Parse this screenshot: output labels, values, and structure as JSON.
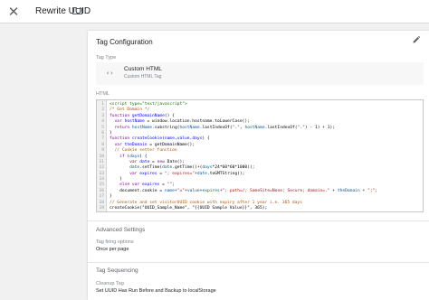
{
  "header": {
    "title": "Rewrite UUID",
    "close_glyph": "✕",
    "icons": [
      "close-icon",
      "folder-icon"
    ]
  },
  "tag_configuration": {
    "title": "Tag Configuration",
    "edit_icon": "pencil-icon",
    "tag_type_label": "Tag Type",
    "tag_type_name": "Custom HTML",
    "tag_type_description": "Custom HTML Tag",
    "tag_type_icon": "code-icon",
    "tag_type_icon_glyph": "‹›",
    "html_label": "HTML",
    "code_lines": [
      {
        "n": "1",
        "parts": [
          {
            "t": "<script type=\"text/javascript\">",
            "c": "c-tag"
          }
        ]
      },
      {
        "n": "2",
        "parts": [
          {
            "t": "/* Get Domain */",
            "c": "c-com"
          }
        ]
      },
      {
        "n": "3",
        "parts": [
          {
            "t": "function ",
            "c": "c-kw"
          },
          {
            "t": "getDomainName",
            "c": "c-def"
          },
          {
            "t": "() {",
            "c": ""
          }
        ]
      },
      {
        "n": "4",
        "parts": [
          {
            "t": "  var ",
            "c": "c-kw"
          },
          {
            "t": "hostName",
            "c": "c-def"
          },
          {
            "t": " = window.location.hostname.toLowerCase();",
            "c": ""
          }
        ]
      },
      {
        "n": "5",
        "parts": [
          {
            "t": "  return ",
            "c": "c-kw"
          },
          {
            "t": "hostName",
            "c": "c-var"
          },
          {
            "t": ".substring(",
            "c": ""
          },
          {
            "t": "hostName",
            "c": "c-var"
          },
          {
            "t": ".lastIndexOf(",
            "c": ""
          },
          {
            "t": "\".\"",
            "c": "c-str"
          },
          {
            "t": ", ",
            "c": ""
          },
          {
            "t": "hostName",
            "c": "c-var"
          },
          {
            "t": ".lastIndexOf(",
            "c": ""
          },
          {
            "t": "\".\"",
            "c": "c-str"
          },
          {
            "t": ") - 1) + 1);",
            "c": ""
          }
        ]
      },
      {
        "n": "6",
        "parts": [
          {
            "t": "}",
            "c": ""
          }
        ]
      },
      {
        "n": "7",
        "parts": [
          {
            "t": "function ",
            "c": "c-kw"
          },
          {
            "t": "createCookie",
            "c": "c-def"
          },
          {
            "t": "(",
            "c": ""
          },
          {
            "t": "name,value,days",
            "c": "c-def"
          },
          {
            "t": ") {",
            "c": ""
          }
        ]
      },
      {
        "n": "8",
        "parts": [
          {
            "t": "  var ",
            "c": "c-kw"
          },
          {
            "t": "theDomain",
            "c": "c-def"
          },
          {
            "t": " = getDomainName();",
            "c": ""
          }
        ]
      },
      {
        "n": "9",
        "parts": [
          {
            "t": "  // Cookie setter function",
            "c": "c-com"
          }
        ]
      },
      {
        "n": "10",
        "parts": [
          {
            "t": "    if ",
            "c": "c-kw"
          },
          {
            "t": "(",
            "c": ""
          },
          {
            "t": "days",
            "c": "c-var"
          },
          {
            "t": ") {",
            "c": ""
          }
        ]
      },
      {
        "n": "11",
        "parts": [
          {
            "t": "        var ",
            "c": "c-kw"
          },
          {
            "t": "date",
            "c": "c-def"
          },
          {
            "t": " = ",
            "c": ""
          },
          {
            "t": "new ",
            "c": "c-kw"
          },
          {
            "t": "Date();",
            "c": ""
          }
        ]
      },
      {
        "n": "12",
        "parts": [
          {
            "t": "        date",
            "c": "c-var"
          },
          {
            "t": ".setTime(",
            "c": ""
          },
          {
            "t": "date",
            "c": "c-var"
          },
          {
            "t": ".getTime()+(",
            "c": ""
          },
          {
            "t": "days",
            "c": "c-var"
          },
          {
            "t": "*24*60*60*1000));",
            "c": ""
          }
        ]
      },
      {
        "n": "13",
        "parts": [
          {
            "t": "        var ",
            "c": "c-kw"
          },
          {
            "t": "expires",
            "c": "c-def"
          },
          {
            "t": " = ",
            "c": ""
          },
          {
            "t": "\"; expires=\"",
            "c": "c-str"
          },
          {
            "t": "+",
            "c": ""
          },
          {
            "t": "date",
            "c": "c-var"
          },
          {
            "t": ".toGMTString();",
            "c": ""
          }
        ]
      },
      {
        "n": "14",
        "parts": [
          {
            "t": "    }",
            "c": ""
          }
        ]
      },
      {
        "n": "15",
        "parts": [
          {
            "t": "    else ",
            "c": "c-kw"
          },
          {
            "t": "var ",
            "c": "c-kw"
          },
          {
            "t": "expires",
            "c": "c-def"
          },
          {
            "t": " = ",
            "c": ""
          },
          {
            "t": "\"\"",
            "c": "c-str"
          },
          {
            "t": ";",
            "c": ""
          }
        ]
      },
      {
        "n": "16",
        "parts": [
          {
            "t": "    document.cookie = ",
            "c": ""
          },
          {
            "t": "name",
            "c": "c-var"
          },
          {
            "t": "+",
            "c": ""
          },
          {
            "t": "\"=\"",
            "c": "c-str"
          },
          {
            "t": "+",
            "c": ""
          },
          {
            "t": "value",
            "c": "c-var"
          },
          {
            "t": "+",
            "c": ""
          },
          {
            "t": "expires",
            "c": "c-var"
          },
          {
            "t": "+",
            "c": ""
          },
          {
            "t": "\"; path=/; SameSite=None; Secure; domain=.\"",
            "c": "c-str"
          },
          {
            "t": " + ",
            "c": ""
          },
          {
            "t": "theDomain",
            "c": "c-var"
          },
          {
            "t": " + ",
            "c": ""
          },
          {
            "t": "\";\"",
            "c": "c-str"
          },
          {
            "t": ";",
            "c": ""
          }
        ]
      },
      {
        "n": "17",
        "parts": [
          {
            "t": "}",
            "c": ""
          }
        ]
      },
      {
        "n": "18",
        "parts": [
          {
            "t": "// Generate and set visitorUUID cookie with expiry after 1 year i.e. 365 days",
            "c": "c-com"
          }
        ]
      },
      {
        "n": "19",
        "parts": [
          {
            "t": "createCookie(\"UUID_Sample_Name\", \"{{UUID Sample Value}}\", 365);",
            "c": ""
          }
        ]
      }
    ],
    "advanced_settings_title": "Advanced Settings",
    "tag_firing_options_label": "Tag firing options",
    "tag_firing_options_value": "Once per page",
    "tag_sequencing_title": "Tag Sequencing",
    "cleanup_tag_label": "Cleanup Tag",
    "cleanup_tag_value": "Set UUID Has Run Before and Backup to localStorage"
  }
}
